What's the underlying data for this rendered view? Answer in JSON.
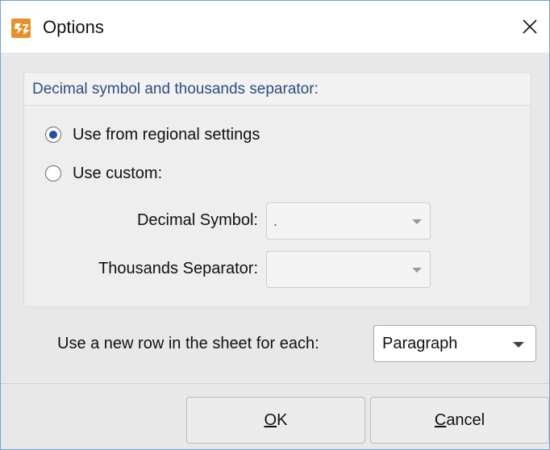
{
  "window": {
    "title": "Options",
    "app_icon": "foxit-app-icon",
    "close_icon": "close-icon"
  },
  "decimal_group": {
    "title": "Decimal symbol and thousands separator:",
    "options": [
      {
        "label": "Use from regional settings",
        "checked": true
      },
      {
        "label": "Use custom:",
        "checked": false
      }
    ],
    "decimal_symbol": {
      "label": "Decimal Symbol:",
      "value": ".",
      "enabled": false
    },
    "thousands_separator": {
      "label": "Thousands Separator:",
      "value": "",
      "enabled": false
    }
  },
  "row_option": {
    "label": "Use a new row in the sheet for each:",
    "selected": "Paragraph"
  },
  "buttons": {
    "ok": {
      "mnemonic": "O",
      "rest": "K"
    },
    "cancel": {
      "mnemonic": "C",
      "rest": "ancel"
    }
  },
  "colors": {
    "accent": "#1f4fa8",
    "group_title": "#2d4f7c",
    "app_icon": "#e8912a",
    "window_border": "#6fa3d9"
  }
}
